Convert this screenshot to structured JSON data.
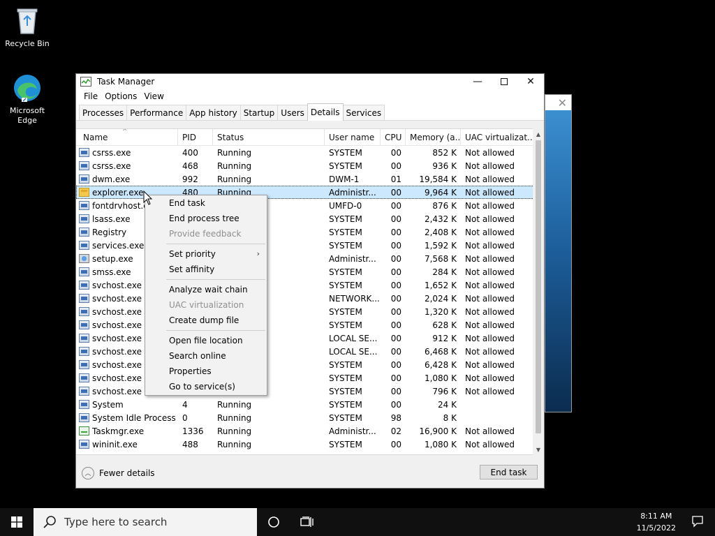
{
  "desktop": {
    "icons": [
      {
        "label": "Recycle Bin",
        "icon": "recycle-bin-icon"
      },
      {
        "label": "Microsoft Edge",
        "icon": "edge-icon"
      }
    ]
  },
  "window": {
    "title": "Task Manager",
    "menu": [
      "File",
      "Options",
      "View"
    ],
    "tabs": [
      "Processes",
      "Performance",
      "App history",
      "Startup",
      "Users",
      "Details",
      "Services"
    ],
    "active_tab": "Details",
    "columns": [
      "Name",
      "PID",
      "Status",
      "User name",
      "CPU",
      "Memory (a...",
      "UAC virtualizat..."
    ],
    "rows": [
      {
        "name": "csrss.exe",
        "pid": "400",
        "status": "Running",
        "user": "SYSTEM",
        "cpu": "00",
        "mem": "852 K",
        "uac": "Not allowed",
        "icon": "process-icon"
      },
      {
        "name": "csrss.exe",
        "pid": "468",
        "status": "Running",
        "user": "SYSTEM",
        "cpu": "00",
        "mem": "936 K",
        "uac": "Not allowed",
        "icon": "process-icon"
      },
      {
        "name": "dwm.exe",
        "pid": "992",
        "status": "Running",
        "user": "DWM-1",
        "cpu": "01",
        "mem": "19,584 K",
        "uac": "Not allowed",
        "icon": "process-icon"
      },
      {
        "name": "explorer.exe",
        "pid": "480",
        "status": "Running",
        "user": "Administr...",
        "cpu": "00",
        "mem": "9,964 K",
        "uac": "Not allowed",
        "icon": "folder-icon",
        "selected": true
      },
      {
        "name": "fontdrvhost.exe",
        "pid": "",
        "status": "",
        "user": "UMFD-0",
        "cpu": "00",
        "mem": "876 K",
        "uac": "Not allowed",
        "icon": "process-icon"
      },
      {
        "name": "lsass.exe",
        "pid": "",
        "status": "",
        "user": "SYSTEM",
        "cpu": "00",
        "mem": "2,432 K",
        "uac": "Not allowed",
        "icon": "process-icon"
      },
      {
        "name": "Registry",
        "pid": "",
        "status": "",
        "user": "SYSTEM",
        "cpu": "00",
        "mem": "2,408 K",
        "uac": "Not allowed",
        "icon": "process-icon"
      },
      {
        "name": "services.exe",
        "pid": "",
        "status": "",
        "user": "SYSTEM",
        "cpu": "00",
        "mem": "1,592 K",
        "uac": "Not allowed",
        "icon": "process-icon"
      },
      {
        "name": "setup.exe",
        "pid": "",
        "status": "",
        "user": "Administr...",
        "cpu": "00",
        "mem": "7,568 K",
        "uac": "Not allowed",
        "icon": "setup-icon"
      },
      {
        "name": "smss.exe",
        "pid": "",
        "status": "",
        "user": "SYSTEM",
        "cpu": "00",
        "mem": "284 K",
        "uac": "Not allowed",
        "icon": "process-icon"
      },
      {
        "name": "svchost.exe",
        "pid": "",
        "status": "",
        "user": "SYSTEM",
        "cpu": "00",
        "mem": "1,652 K",
        "uac": "Not allowed",
        "icon": "process-icon"
      },
      {
        "name": "svchost.exe",
        "pid": "",
        "status": "",
        "user": "NETWORK...",
        "cpu": "00",
        "mem": "2,024 K",
        "uac": "Not allowed",
        "icon": "process-icon"
      },
      {
        "name": "svchost.exe",
        "pid": "",
        "status": "",
        "user": "SYSTEM",
        "cpu": "00",
        "mem": "1,320 K",
        "uac": "Not allowed",
        "icon": "process-icon"
      },
      {
        "name": "svchost.exe",
        "pid": "",
        "status": "",
        "user": "SYSTEM",
        "cpu": "00",
        "mem": "628 K",
        "uac": "Not allowed",
        "icon": "process-icon"
      },
      {
        "name": "svchost.exe",
        "pid": "",
        "status": "",
        "user": "LOCAL SE...",
        "cpu": "00",
        "mem": "912 K",
        "uac": "Not allowed",
        "icon": "process-icon"
      },
      {
        "name": "svchost.exe",
        "pid": "",
        "status": "",
        "user": "LOCAL SE...",
        "cpu": "00",
        "mem": "6,468 K",
        "uac": "Not allowed",
        "icon": "process-icon"
      },
      {
        "name": "svchost.exe",
        "pid": "",
        "status": "",
        "user": "SYSTEM",
        "cpu": "00",
        "mem": "6,428 K",
        "uac": "Not allowed",
        "icon": "process-icon"
      },
      {
        "name": "svchost.exe",
        "pid": "",
        "status": "",
        "user": "SYSTEM",
        "cpu": "00",
        "mem": "1,080 K",
        "uac": "Not allowed",
        "icon": "process-icon"
      },
      {
        "name": "svchost.exe",
        "pid": "",
        "status": "",
        "user": "SYSTEM",
        "cpu": "00",
        "mem": "796 K",
        "uac": "Not allowed",
        "icon": "process-icon"
      },
      {
        "name": "System",
        "pid": "4",
        "status": "Running",
        "user": "SYSTEM",
        "cpu": "00",
        "mem": "24 K",
        "uac": "",
        "icon": "process-icon"
      },
      {
        "name": "System Idle Process",
        "pid": "0",
        "status": "Running",
        "user": "SYSTEM",
        "cpu": "98",
        "mem": "8 K",
        "uac": "",
        "icon": "process-icon"
      },
      {
        "name": "Taskmgr.exe",
        "pid": "1336",
        "status": "Running",
        "user": "Administr...",
        "cpu": "02",
        "mem": "16,900 K",
        "uac": "Not allowed",
        "icon": "task-manager-icon"
      },
      {
        "name": "wininit.exe",
        "pid": "488",
        "status": "Running",
        "user": "SYSTEM",
        "cpu": "00",
        "mem": "1,080 K",
        "uac": "Not allowed",
        "icon": "process-icon"
      }
    ],
    "footer": {
      "fewer_details": "Fewer details",
      "end_task": "End task"
    }
  },
  "context_menu": {
    "groups": [
      [
        {
          "label": "End task",
          "disabled": false
        },
        {
          "label": "End process tree",
          "disabled": false
        },
        {
          "label": "Provide feedback",
          "disabled": true
        }
      ],
      [
        {
          "label": "Set priority",
          "disabled": false,
          "submenu": true
        },
        {
          "label": "Set affinity",
          "disabled": false
        }
      ],
      [
        {
          "label": "Analyze wait chain",
          "disabled": false
        },
        {
          "label": "UAC virtualization",
          "disabled": true
        },
        {
          "label": "Create dump file",
          "disabled": false
        }
      ],
      [
        {
          "label": "Open file location",
          "disabled": false
        },
        {
          "label": "Search online",
          "disabled": false
        },
        {
          "label": "Properties",
          "disabled": false
        },
        {
          "label": "Go to service(s)",
          "disabled": false
        }
      ]
    ]
  },
  "taskbar": {
    "search_placeholder": "Type here to search",
    "time": "8:11 AM",
    "date": "11/5/2022"
  }
}
